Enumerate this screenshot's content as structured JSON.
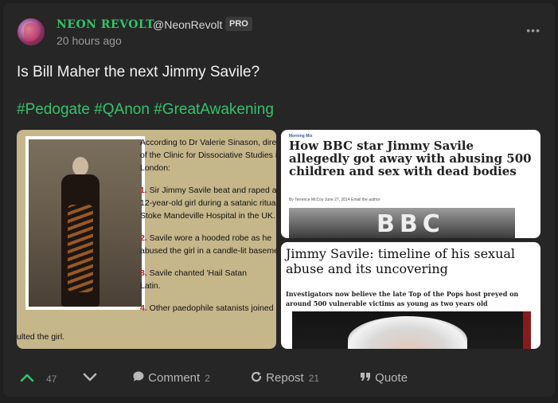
{
  "author": {
    "name": "NEON REVOLT",
    "handle": "@NeonRevolt",
    "badge": "PRO",
    "time": "20 hours ago"
  },
  "menu_icon": "more-dots-icon",
  "post": {
    "text": "Is Bill Maher the next Jimmy Savile?",
    "hashtags": [
      "#Pedogate",
      "#QAnon",
      "#GreatAwakening"
    ]
  },
  "image_left": {
    "intro1": "According to Dr Valerie Sinason, dire",
    "intro2": "of the Clinic for Dissociative Studies i",
    "intro3": "London:",
    "p1_num": "1.",
    "p1a": " Sir Jimmy Savile beat and raped a",
    "p1b": "12-year-old girl during a satanic ritual",
    "p1c": "Stoke Mandeville Hospital in the UK.",
    "p2_num": "2.",
    "p2a": " Savile wore a hooded robe as he",
    "p2b": "abused the girl in a candle-lit baseme",
    "p3_num": "3.",
    "p3a": " Savile chanted 'Hail Satan",
    "p3b": "Latin.",
    "p4_num": "4.",
    "p4a": " Other paedophile satanists joined i",
    "tail": "ulted the girl."
  },
  "image_right_top": {
    "kicker": "Morning Mix",
    "headline": "How BBC star Jimmy Savile allegedly got away with abusing 500 children and sex with dead bodies",
    "byline": "By Terrence McCoy  June 27, 2014  Email the author",
    "sign": "BBC"
  },
  "image_right_bottom": {
    "headline": "Jimmy Savile: timeline of his sexual abuse and its uncovering",
    "subhead": "Investigators now believe the late Top of the Pops host preyed on around 500 vulnerable victims as young as two years old"
  },
  "actions": {
    "upvotes": "47",
    "comment_label": "Comment",
    "comment_count": "2",
    "repost_label": "Repost",
    "repost_count": "21",
    "quote_label": "Quote"
  },
  "colors": {
    "accent": "#31c46b",
    "background": "#262626",
    "text": "#f2f2f2"
  }
}
